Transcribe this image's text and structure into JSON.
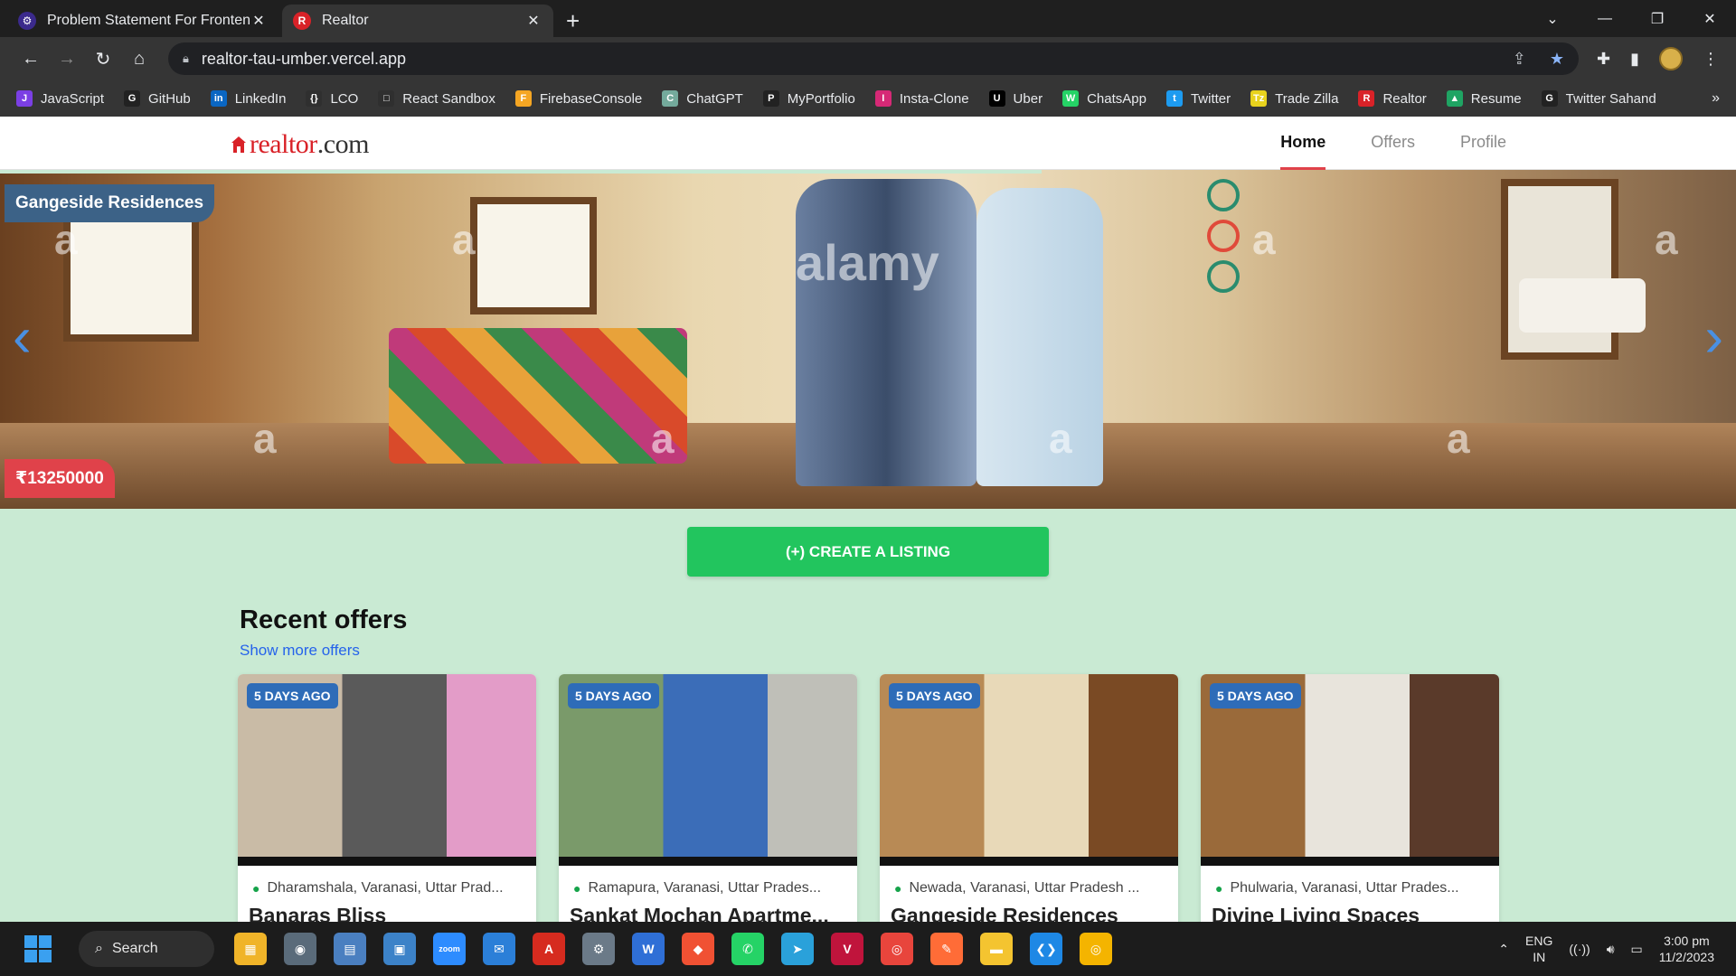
{
  "browser": {
    "tabs": [
      {
        "title": "Problem Statement For Frontend",
        "favicon_color": "#3b2a8c",
        "favicon_text": "⚙",
        "active": false
      },
      {
        "title": "Realtor",
        "favicon_color": "#d92228",
        "favicon_text": "R",
        "active": true
      }
    ],
    "new_tab_label": "+",
    "url": "realtor-tau-umber.vercel.app",
    "bookmarks_more": "»",
    "bookmarks": [
      {
        "label": "JavaScript",
        "icon_color": "#7b3fe4",
        "icon_text": "J"
      },
      {
        "label": "GitHub",
        "icon_color": "#222222",
        "icon_text": "G"
      },
      {
        "label": "LinkedIn",
        "icon_color": "#0a66c2",
        "icon_text": "in"
      },
      {
        "label": "LCO",
        "icon_color": "#2f2f2f",
        "icon_text": "{}"
      },
      {
        "label": "React Sandbox",
        "icon_color": "#2f2f2f",
        "icon_text": "□"
      },
      {
        "label": "FirebaseConsole",
        "icon_color": "#f5a623",
        "icon_text": "F"
      },
      {
        "label": "ChatGPT",
        "icon_color": "#74aa9c",
        "icon_text": "C"
      },
      {
        "label": "MyPortfolio",
        "icon_color": "#222222",
        "icon_text": "P"
      },
      {
        "label": "Insta-Clone",
        "icon_color": "#d62976",
        "icon_text": "I"
      },
      {
        "label": "Uber",
        "icon_color": "#000000",
        "icon_text": "U"
      },
      {
        "label": "ChatsApp",
        "icon_color": "#25d366",
        "icon_text": "W"
      },
      {
        "label": "Twitter",
        "icon_color": "#1d9bf0",
        "icon_text": "t"
      },
      {
        "label": "Trade Zilla",
        "icon_color": "#e8d21d",
        "icon_text": "Tz"
      },
      {
        "label": "Realtor",
        "icon_color": "#d92228",
        "icon_text": "R"
      },
      {
        "label": "Resume",
        "icon_color": "#1fa463",
        "icon_text": "▲"
      },
      {
        "label": "Twitter Sahand",
        "icon_color": "#222222",
        "icon_text": "G"
      }
    ]
  },
  "site": {
    "logo_text": "realtor",
    "logo_suffix": ".com",
    "nav": [
      {
        "label": "Home",
        "active": true
      },
      {
        "label": "Offers",
        "active": false
      },
      {
        "label": "Profile",
        "active": false
      }
    ],
    "hero": {
      "title": "Gangeside Residences",
      "price": "₹13250000",
      "watermark": "a",
      "watermark_brand": "alamy",
      "prev_icon": "‹",
      "next_icon": "›"
    },
    "create_button": "(+) CREATE A LISTING",
    "recent_title": "Recent offers",
    "show_more": "Show more offers",
    "offers": [
      {
        "badge": "5 DAYS AGO",
        "location": "Dharamshala, Varanasi, Uttar Prad...",
        "name": "Banaras Bliss",
        "theme": [
          "#c9bba6",
          "#5a5a5a",
          "#e39cc8"
        ]
      },
      {
        "badge": "5 DAYS AGO",
        "location": "Ramapura, Varanasi, Uttar Prades...",
        "name": "Sankat Mochan Apartme...",
        "theme": [
          "#7a9a6a",
          "#3b6db8",
          "#bfbfb8"
        ]
      },
      {
        "badge": "5 DAYS AGO",
        "location": "Newada, Varanasi, Uttar Pradesh ...",
        "name": "Gangeside Residences",
        "theme": [
          "#b88a55",
          "#e8d9b8",
          "#7a4a24"
        ]
      },
      {
        "badge": "5 DAYS AGO",
        "location": "Phulwaria, Varanasi, Uttar Prades...",
        "name": "Divine Living Spaces",
        "theme": [
          "#9a6a3a",
          "#e8e4dc",
          "#5a3a2a"
        ]
      }
    ]
  },
  "taskbar": {
    "search_label": "Search",
    "apps": [
      {
        "name": "file-explorer",
        "color": "#f0b429",
        "text": "▦"
      },
      {
        "name": "camera",
        "color": "#5a6b7a",
        "text": "◉"
      },
      {
        "name": "calculator",
        "color": "#4a7fc0",
        "text": "▤"
      },
      {
        "name": "control-panel",
        "color": "#3c82c8",
        "text": "▣"
      },
      {
        "name": "zoom",
        "color": "#2d8cff",
        "text": "zoom"
      },
      {
        "name": "mail",
        "color": "#2b7fd8",
        "text": "✉"
      },
      {
        "name": "acrobat",
        "color": "#d62b1f",
        "text": "A"
      },
      {
        "name": "settings",
        "color": "#6b7a88",
        "text": "⚙"
      },
      {
        "name": "wps",
        "color": "#2f6fd6",
        "text": "W"
      },
      {
        "name": "git",
        "color": "#f05133",
        "text": "◆"
      },
      {
        "name": "whatsapp",
        "color": "#25d366",
        "text": "✆"
      },
      {
        "name": "telegram",
        "color": "#2aa1da",
        "text": "➤"
      },
      {
        "name": "vscode-insiders",
        "color": "#c0143c",
        "text": "V"
      },
      {
        "name": "chrome",
        "color": "#e8453c",
        "text": "◎"
      },
      {
        "name": "postman",
        "color": "#ff6c37",
        "text": "✎"
      },
      {
        "name": "folder",
        "color": "#f4c430",
        "text": "▬"
      },
      {
        "name": "vscode",
        "color": "#1e88e5",
        "text": "❮❯"
      },
      {
        "name": "chrome-active",
        "color": "#f4b400",
        "text": "◎"
      }
    ],
    "lang_line1": "ENG",
    "lang_line2": "IN",
    "time": "3:00 pm",
    "date": "11/2/2023"
  }
}
